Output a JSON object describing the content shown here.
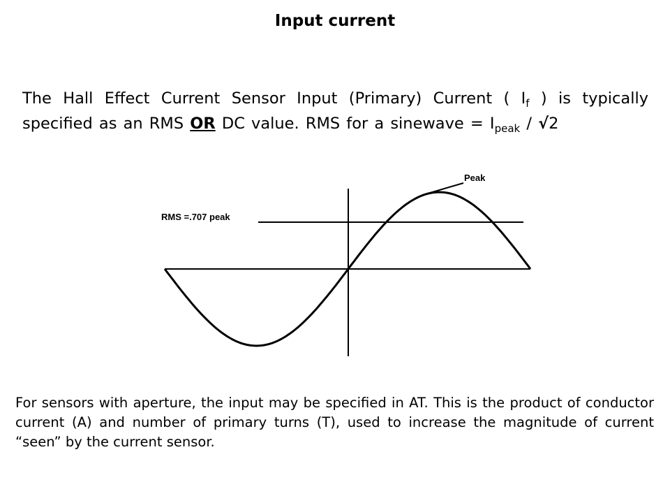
{
  "slide": {
    "title": "Input current",
    "paragraph1": {
      "part1": "The Hall Effect Current Sensor Input (Primary) Current ( ",
      "symbol_main": "I",
      "symbol_sub": "f",
      "part2": " ) is typically specified as an RMS ",
      "emphasis": "OR",
      "part3": " DC value. RMS for a sinewave = ",
      "formula_main": "I",
      "formula_sub": "peak",
      "formula_div": " / ",
      "sqrt_symbol": "√",
      "formula_num": "2"
    },
    "paragraph2": "For sensors with aperture, the input may be specified in AT. This is the product of conductor current (A) and number of primary turns (T), used to increase the magnitude of current “seen” by the current sensor."
  },
  "diagram": {
    "rms_label": "RMS =.707 peak",
    "peak_label": "Peak",
    "rms_fraction_of_peak": 0.707,
    "waveform": "sine",
    "cycles": 1
  }
}
